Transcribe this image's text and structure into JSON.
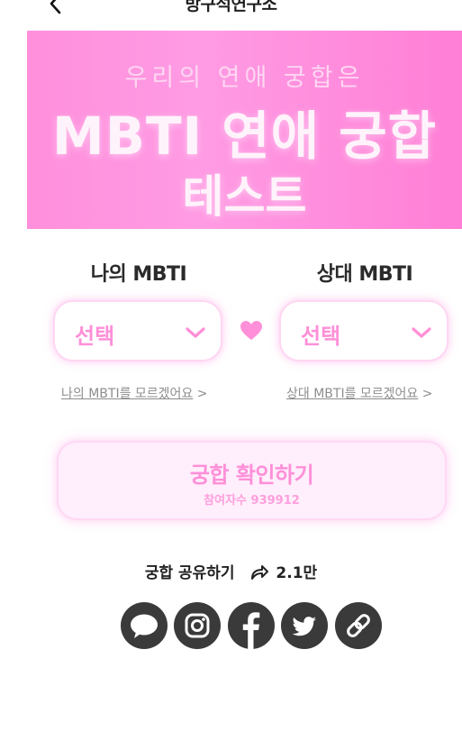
{
  "header": {
    "title": "방구석연구소"
  },
  "banner": {
    "subtitle": "우리의 연애 궁합은",
    "title_line1": "MBTI 연애 궁합",
    "title_line2": "테스트"
  },
  "my_mbti": {
    "label": "나의 MBTI",
    "select_value": "선택",
    "unknown_link": "나의 MBTI를 모르겠어요",
    "unknown_arrow": ">"
  },
  "partner_mbti": {
    "label": "상대 MBTI",
    "select_value": "선택",
    "unknown_link": "상대 MBTI를 모르겠어요",
    "unknown_arrow": ">"
  },
  "check_button": {
    "label": "궁합 확인하기",
    "participants": "참여자수 939912"
  },
  "share": {
    "label": "궁합 공유하기",
    "count": "2.1만"
  },
  "social_icons": [
    "kakao-talk-icon",
    "instagram-icon",
    "facebook-icon",
    "twitter-icon",
    "link-icon"
  ],
  "colors": {
    "accent_pink": "#ff8fd8",
    "banner_pink": "#ff8fdc",
    "icon_dark": "#3a3a3a"
  }
}
